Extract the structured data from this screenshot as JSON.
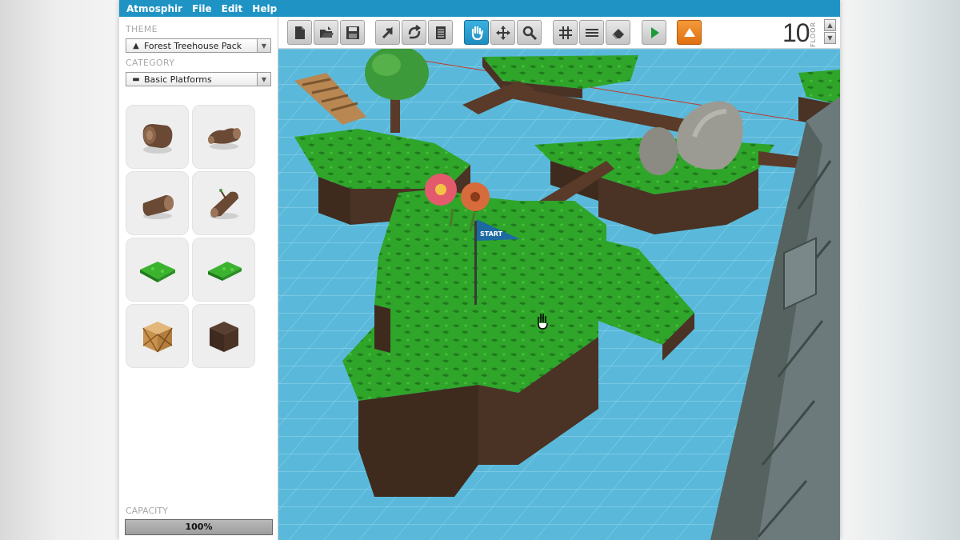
{
  "menubar": {
    "app_name": "Atmosphir",
    "items": [
      "File",
      "Edit",
      "Help"
    ]
  },
  "sidebar": {
    "theme_label": "THEME",
    "theme_value": "Forest Treehouse Pack",
    "theme_icon": "tree-icon",
    "category_label": "CATEGORY",
    "category_value": "Basic Platforms",
    "category_icon": "platform-icon",
    "tiles": [
      {
        "name": "log-stump-icon"
      },
      {
        "name": "log-bent-icon"
      },
      {
        "name": "log-short-icon"
      },
      {
        "name": "log-branch-icon"
      },
      {
        "name": "grass-tile-flat-icon"
      },
      {
        "name": "grass-tile-angled-icon"
      },
      {
        "name": "wooden-crate-icon"
      },
      {
        "name": "dark-crate-icon"
      }
    ],
    "capacity_label": "CAPACITY",
    "capacity_text": "100%",
    "capacity_fraction": 1.0
  },
  "toolbar": {
    "buttons": [
      {
        "name": "new-document-button",
        "icon": "document-icon"
      },
      {
        "name": "open-button",
        "icon": "folder-open-icon"
      },
      {
        "name": "save-button",
        "icon": "floppy-disk-icon"
      },
      {
        "name": "select-button",
        "icon": "arrow-cursor-icon"
      },
      {
        "name": "rotate-button",
        "icon": "rotate-arrows-icon"
      },
      {
        "name": "properties-button",
        "icon": "list-icon"
      },
      {
        "name": "hand-tool-button",
        "icon": "hand-icon",
        "active": true
      },
      {
        "name": "move-tool-button",
        "icon": "move-arrows-icon"
      },
      {
        "name": "zoom-tool-button",
        "icon": "magnifier-icon"
      },
      {
        "name": "grid-toggle-button",
        "icon": "grid-icon"
      },
      {
        "name": "align-button",
        "icon": "lines-icon"
      },
      {
        "name": "eraser-button",
        "icon": "eraser-icon"
      },
      {
        "name": "play-button",
        "icon": "play-icon"
      },
      {
        "name": "upload-button",
        "icon": "up-triangle-icon"
      }
    ],
    "floor_number": "10",
    "floor_label": "FLOOR"
  },
  "viewport": {
    "flag_text": "START",
    "colors": {
      "water": "#5ab9da",
      "grid": "#8fd3ea",
      "grass": "#2fa52a",
      "grass_dark": "#1f7a1c",
      "soil": "#4a3224",
      "rock": "#9b9b93",
      "flag": "#1d6aa3"
    }
  }
}
